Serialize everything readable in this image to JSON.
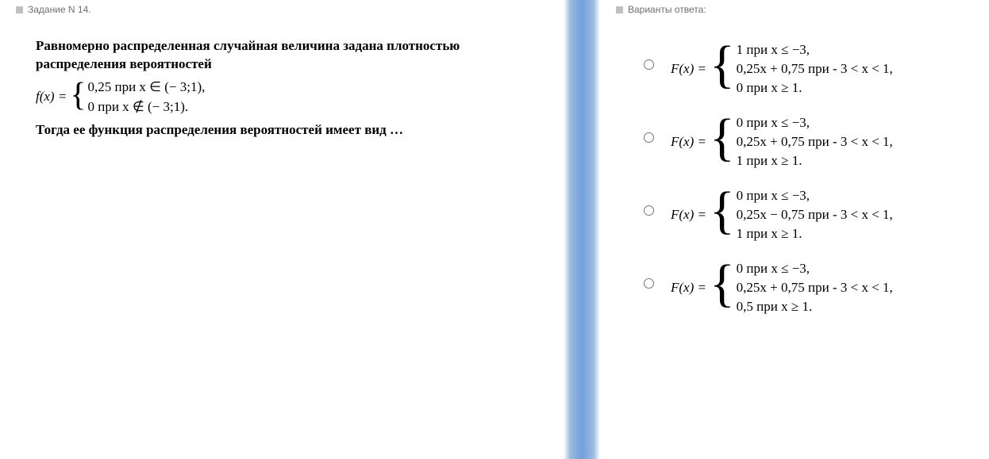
{
  "left": {
    "header": "Задание N 14.",
    "intro_line1": "Равномерно распределенная случайная величина задана плотностью",
    "intro_line2": "распределения вероятностей",
    "pdf_label": "f(x) =",
    "pdf_case1": "0,25  при   x ∈ (− 3;1),",
    "pdf_case2": "0    при   x ∉ (− 3;1).",
    "outro": "Тогда ее функция распределения вероятностей имеет вид …"
  },
  "right": {
    "header": "Варианты ответа:",
    "fx_label": "F(x) =",
    "answers": [
      {
        "c1": "1  при   x ≤ −3,",
        "c2": "0,25x + 0,75   при  - 3 < x < 1,",
        "c3": "0   при   x ≥ 1."
      },
      {
        "c1": "0  при   x ≤ −3,",
        "c2": "0,25x + 0,75   при  - 3 < x < 1,",
        "c3": "1   при   x ≥ 1."
      },
      {
        "c1": "0  при   x ≤ −3,",
        "c2": "0,25x − 0,75   при  - 3 < x < 1,",
        "c3": "1   при   x ≥ 1."
      },
      {
        "c1": "0  при   x ≤ −3,",
        "c2": "0,25x + 0,75   при  - 3 < x < 1,",
        "c3": "0,5   при   x ≥ 1."
      }
    ]
  }
}
